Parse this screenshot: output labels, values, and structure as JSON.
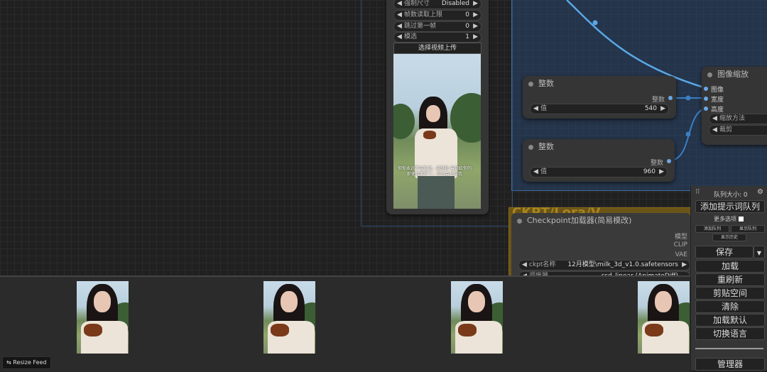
{
  "canvas": {
    "video_node": {
      "widgets": [
        {
          "label": "强制尺寸",
          "value": "Disabled"
        },
        {
          "label": "帧数读取上限",
          "value": "0"
        },
        {
          "label": "跳过第一帧",
          "value": "0"
        },
        {
          "label": "模选",
          "value": "1"
        }
      ],
      "upload_label": "选择视频上传",
      "subtitle_line1": "但你永远不会忘记，这是我 曾经给你的",
      "subtitle_line2": "即使我离开了，你也会记得我"
    },
    "int_node_1": {
      "title": "整数",
      "output": "整数",
      "widget_label": "值",
      "widget_value": "540"
    },
    "int_node_2": {
      "title": "整数",
      "output": "整数",
      "widget_label": "值",
      "widget_value": "960"
    },
    "scale_node": {
      "title": "图像缩放",
      "inputs": [
        "图像",
        "宽度",
        "高度"
      ],
      "widgets": [
        "缩放方法",
        "裁剪"
      ]
    },
    "ckpt_group_title": "CKPT/Lora/V",
    "ckpt_node": {
      "title": "Checkpoint加载器(简易模改)",
      "outputs": [
        "模型",
        "CLIP",
        "VAE"
      ],
      "ckpt_label": "ckpt名称",
      "ckpt_value": "12月模型\\milk_3d_v1.0.safetensors",
      "second_label": "调度器",
      "second_value": "ssd_linear (AnimateDiff)"
    }
  },
  "feed": {
    "resize_label": "Resize Feed",
    "resize_icon": "swap-arrows-icon"
  },
  "panel": {
    "queue_size": "队列大小: 0",
    "add_queue": "添加提示词队列",
    "more_options": "更多选项",
    "small_btns": [
      "添加队列",
      "显示队列",
      "显示历史"
    ],
    "save": "保存",
    "load": "加载",
    "refresh": "重刷新",
    "clipspace": "剪贴空间",
    "clear": "清除",
    "load_default": "加载默认",
    "switch_lang": "切换语言",
    "manager": "管理器"
  },
  "colors": {
    "link_blue": "#5aa7e6",
    "group_blue": "#28466e",
    "group_orange": "#6b5418"
  }
}
